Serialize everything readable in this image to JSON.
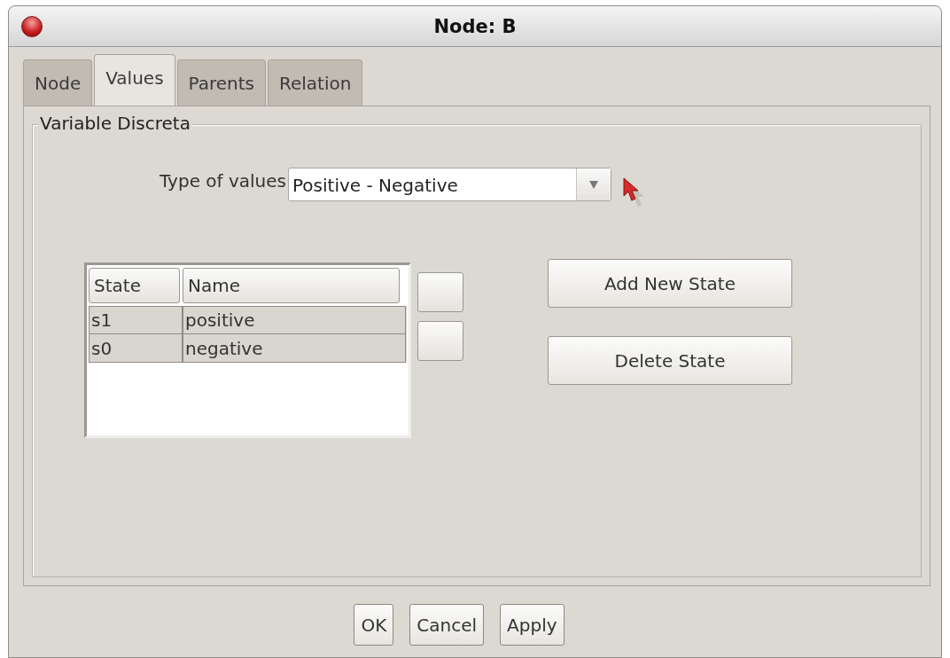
{
  "window": {
    "title": "Node: B"
  },
  "tabs": [
    {
      "label": "Node",
      "selected": false
    },
    {
      "label": "Values",
      "selected": true
    },
    {
      "label": "Parents",
      "selected": false
    },
    {
      "label": "Relation",
      "selected": false
    }
  ],
  "group": {
    "title": "Variable Discreta"
  },
  "type_of_values": {
    "label": "Type of values",
    "value": "Positive - Negative"
  },
  "table": {
    "columns": [
      "State",
      "Name"
    ],
    "rows": [
      [
        "s1",
        "positive"
      ],
      [
        "s0",
        "negative"
      ]
    ]
  },
  "state_buttons": [
    "Add New State",
    "Delete State"
  ],
  "buttons": [
    "OK",
    "Cancel",
    "Apply"
  ]
}
